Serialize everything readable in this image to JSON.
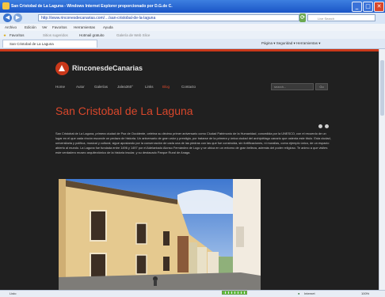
{
  "window": {
    "title": "San Cristobal de La Laguna - Windows Internet Explorer proporcionado por D.G.de C.",
    "controls": [
      "_",
      "□",
      "✕"
    ]
  },
  "address": {
    "url": "http://www.rinconesdecanarias.com/…/san-cristobal-de-la-laguna",
    "search_placeholder": "Live Search"
  },
  "menu": [
    "Archivo",
    "Edición",
    "Ver",
    "Favoritos",
    "Herramientas",
    "Ayuda"
  ],
  "favorites": {
    "label": "Favoritos",
    "items": [
      "Sitios sugeridos",
      "Hotmail gratuito",
      "Galería de Web Slice"
    ]
  },
  "tab": {
    "label": "San Cristobal de La Laguna"
  },
  "commandbar": "Página ▾  Seguridad ▾  Herramientas ▾",
  "site": {
    "logo_text": "RinconesdeCanarias",
    "nav": [
      "Home",
      "Autor",
      "Galerías",
      "Jalea360°",
      "Links",
      "Blog",
      "Contacto"
    ],
    "active_nav": "Blog",
    "search_placeholder": "search...",
    "search_button": "Go",
    "page_title": "San Cristobal de La Laguna",
    "article": "San Cristobal de La Laguna, primera ciudad de Paz de Occidente, celebra su décimo primer aniversario como Ciudad Patrimonio de la Humanidad, concedida por la UNESCO, con el recuerdo de un lugar en el que cada rincón esconde un pedazo de historia. Un aniversario de gran valor y prestigio, por tratarse de la primera y única ciudad del archipiélago canario que ostenta este título. Esta ciudad, universitaria y política, musical y cultural, sigue apostando por la conservación de cada una de las piedras con las que fue construida, sin fortificaciones, ni murallas, como ejemplo único, de un espacio abierto al mundo. La Laguna fue fundada entre 1496 y 1497 por el Adelantado Alonso Fernández de Lugo y se ubica en un entorno de gran belleza, además del poder religioso. Te animo a que visites este verdadero museo arquitectónico de la historia insular, y su destacado Parque Rural de Anaga."
  },
  "status": {
    "left": "Listo",
    "zone": "Internet",
    "zoom": "100%"
  }
}
